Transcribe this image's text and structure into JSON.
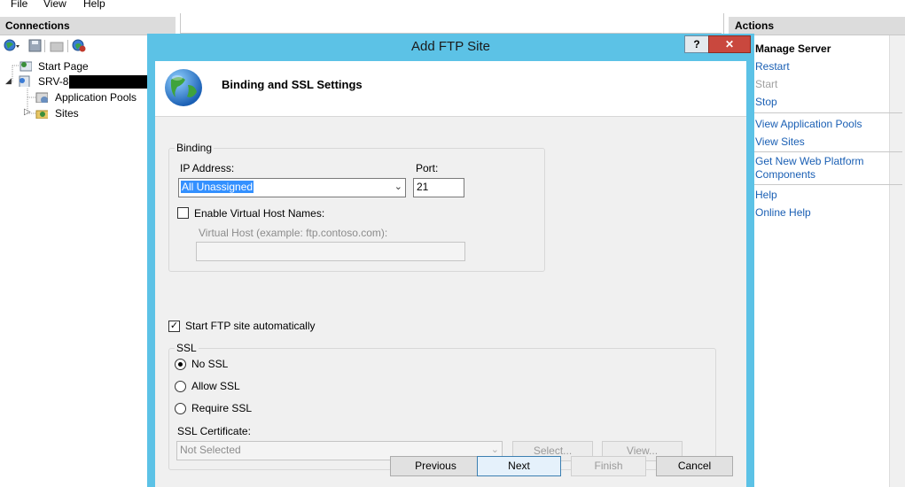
{
  "menu": [
    "File",
    "View",
    "Help"
  ],
  "connections": {
    "header": "Connections",
    "tree": [
      {
        "label": "Start Page"
      },
      {
        "label": "SRV-8"
      },
      {
        "label": "Application Pools"
      },
      {
        "label": "Sites"
      }
    ]
  },
  "actions": {
    "header": "Actions",
    "section_title": "Manage Server",
    "items": [
      {
        "label": "Restart"
      },
      {
        "label": "Start"
      },
      {
        "label": "Stop"
      },
      {
        "label": "View Application Pools"
      },
      {
        "label": "View Sites"
      },
      {
        "label": "Get New Web Platform"
      },
      {
        "label": "Components"
      },
      {
        "label": "Help"
      },
      {
        "label": "Online Help"
      }
    ]
  },
  "dialog": {
    "title": "Add FTP Site",
    "help_label": "?",
    "close_label": "✕",
    "heading": "Binding and SSL Settings",
    "binding": {
      "group_label": "Binding",
      "ip_label": "IP Address:",
      "ip_value": "All Unassigned",
      "port_label": "Port:",
      "port_value": "21",
      "virtual_host_check_label": "Enable Virtual Host Names:",
      "virtual_host_checked": false,
      "virtual_host_label": "Virtual Host (example: ftp.contoso.com):",
      "virtual_host_value": ""
    },
    "start_auto_label": "Start FTP site automatically",
    "start_auto_checked": true,
    "ssl": {
      "group_label": "SSL",
      "options": [
        "No SSL",
        "Allow SSL",
        "Require SSL"
      ],
      "selected": "No SSL",
      "cert_label": "SSL Certificate:",
      "cert_value": "Not Selected",
      "select_button": "Select...",
      "view_button": "View..."
    },
    "buttons": {
      "previous": "Previous",
      "next": "Next",
      "finish": "Finish",
      "cancel": "Cancel"
    }
  }
}
